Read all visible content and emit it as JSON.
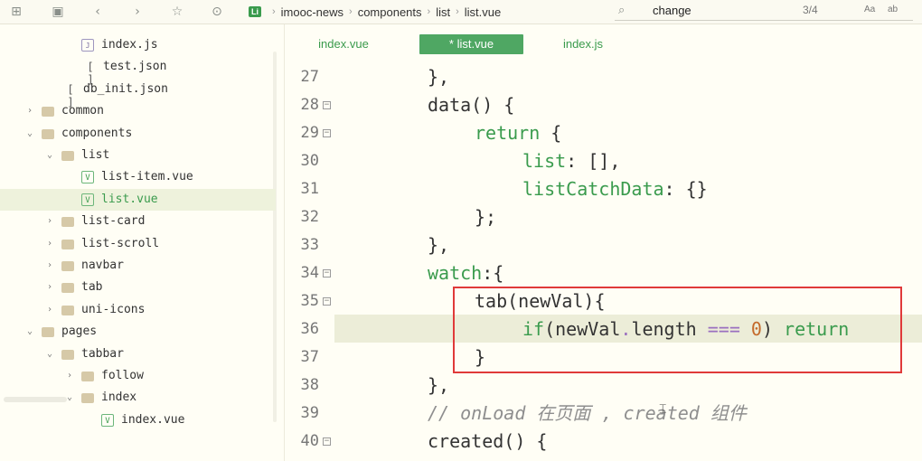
{
  "toolbar": {
    "icons": [
      "new-file-icon",
      "save-icon",
      "back-icon",
      "forward-icon",
      "star-icon",
      "run-icon"
    ]
  },
  "breadcrumb": {
    "badge": "Li",
    "items": [
      "imooc-news",
      "components",
      "list",
      "list.vue"
    ]
  },
  "search": {
    "value": "change",
    "count": "3/4",
    "opt1": "Aa",
    "opt2": "ab"
  },
  "tree": [
    {
      "label": "index.js",
      "type": "js",
      "depth": 3,
      "arrow": ""
    },
    {
      "label": "test.json",
      "type": "json",
      "depth": 3,
      "arrow": ""
    },
    {
      "label": "db_init.json",
      "type": "json",
      "depth": 2,
      "arrow": ""
    },
    {
      "label": "common",
      "type": "folder",
      "depth": 1,
      "arrow": "›"
    },
    {
      "label": "components",
      "type": "folder",
      "depth": 1,
      "arrow": "⌄"
    },
    {
      "label": "list",
      "type": "folder",
      "depth": 2,
      "arrow": "⌄"
    },
    {
      "label": "list-item.vue",
      "type": "vue",
      "depth": 3,
      "arrow": ""
    },
    {
      "label": "list.vue",
      "type": "vue",
      "depth": 3,
      "arrow": "",
      "active": true
    },
    {
      "label": "list-card",
      "type": "folder",
      "depth": 2,
      "arrow": "›"
    },
    {
      "label": "list-scroll",
      "type": "folder",
      "depth": 2,
      "arrow": "›"
    },
    {
      "label": "navbar",
      "type": "folder",
      "depth": 2,
      "arrow": "›"
    },
    {
      "label": "tab",
      "type": "folder",
      "depth": 2,
      "arrow": "›"
    },
    {
      "label": "uni-icons",
      "type": "folder",
      "depth": 2,
      "arrow": "›"
    },
    {
      "label": "pages",
      "type": "folder",
      "depth": 1,
      "arrow": "⌄"
    },
    {
      "label": "tabbar",
      "type": "folder",
      "depth": 2,
      "arrow": "⌄"
    },
    {
      "label": "follow",
      "type": "folder",
      "depth": 3,
      "arrow": "›"
    },
    {
      "label": "index",
      "type": "folder",
      "depth": 3,
      "arrow": "⌄"
    },
    {
      "label": "index.vue",
      "type": "vue",
      "depth": 4,
      "arrow": ""
    }
  ],
  "tabs": [
    {
      "label": "index.vue",
      "active": false
    },
    {
      "label": "* list.vue",
      "active": true
    },
    {
      "label": "index.js",
      "active": false
    }
  ],
  "code": {
    "lines": [
      {
        "n": "27",
        "fold": false
      },
      {
        "n": "28",
        "fold": true
      },
      {
        "n": "29",
        "fold": true
      },
      {
        "n": "30",
        "fold": false
      },
      {
        "n": "31",
        "fold": false
      },
      {
        "n": "32",
        "fold": false
      },
      {
        "n": "33",
        "fold": false
      },
      {
        "n": "34",
        "fold": true
      },
      {
        "n": "35",
        "fold": true
      },
      {
        "n": "36",
        "fold": false
      },
      {
        "n": "37",
        "fold": false
      },
      {
        "n": "38",
        "fold": false
      },
      {
        "n": "39",
        "fold": false
      },
      {
        "n": "40",
        "fold": true
      }
    ],
    "t27": "},",
    "t28": "data() {",
    "t29a": "return",
    "t29b": " {",
    "t30a": "list",
    "t30b": ": [],",
    "t31a": "listCatchData",
    "t31b": ": {}",
    "t32": "};",
    "t33": "},",
    "t34a": "watch",
    "t34b": ":{",
    "t35": "tab(newVal){",
    "t36a": "if",
    "t36b": "(newVal",
    "t36c": ".",
    "t36d": "length ",
    "t36e": "===",
    "t36f": " ",
    "t36g": "0",
    "t36h": ") ",
    "t36i": "return",
    "t37": "}",
    "t38": "},",
    "t39": "// onLoad 在页面 , created 组件",
    "t40": "created() {"
  }
}
